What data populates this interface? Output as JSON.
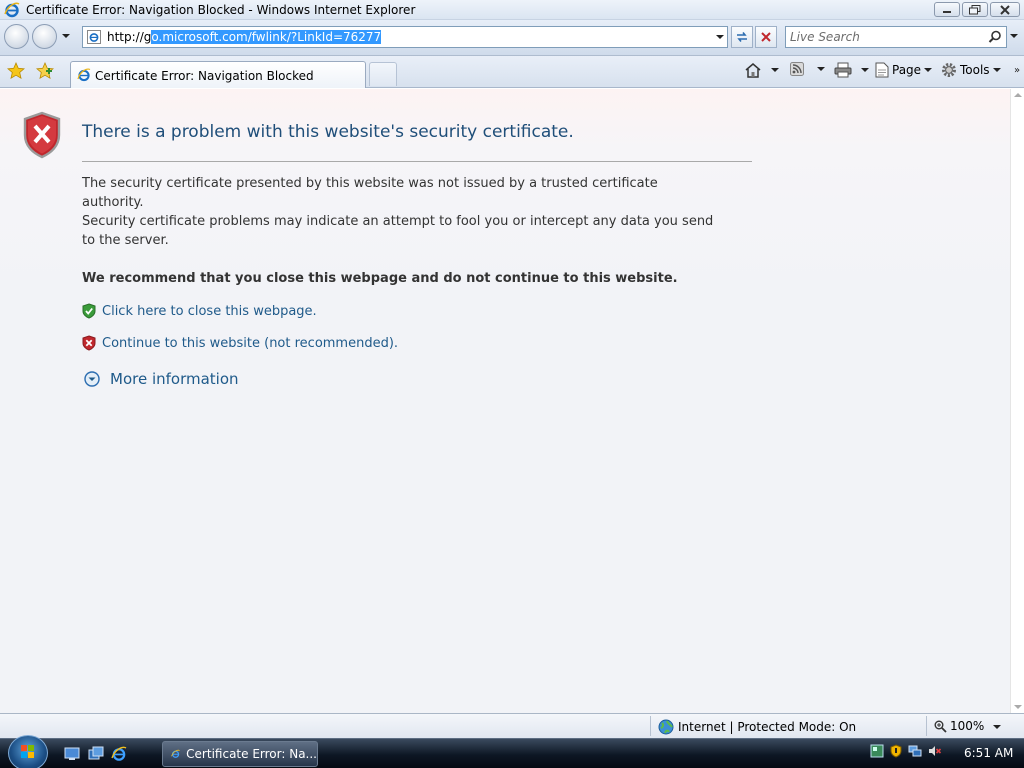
{
  "window": {
    "title": "Certificate Error: Navigation Blocked - Windows Internet Explorer"
  },
  "navbar": {
    "url_prefix": "http://g",
    "url_selected": "o.microsoft.com/fwlink/?LinkId=76277",
    "search_placeholder": "Live Search"
  },
  "tabs": {
    "active_label": "Certificate Error: Navigation Blocked"
  },
  "commands": {
    "page_label": "Page",
    "tools_label": "Tools"
  },
  "content": {
    "heading": "There is a problem with this website's security certificate.",
    "paragraph1": "The security certificate presented by this website was not issued by a trusted certificate authority.",
    "paragraph2": "Security certificate problems may indicate an attempt to fool you or intercept any data you send to the server.",
    "recommendation": "We recommend that you close this webpage and do not continue to this website.",
    "close_link": "Click here to close this webpage.",
    "continue_link": "Continue to this website (not recommended).",
    "more_info": "More information"
  },
  "statusbar": {
    "zone": "Internet | Protected Mode: On",
    "zoom": "100%"
  },
  "taskbar": {
    "task_label": "Certificate Error: Na...",
    "clock": "6:51 AM"
  },
  "colors": {
    "link": "#1f5a8a",
    "heading": "#1f4e79",
    "shield_red": "#c0272d",
    "shield_green": "#3a9b3a",
    "selection": "#3399ff"
  }
}
